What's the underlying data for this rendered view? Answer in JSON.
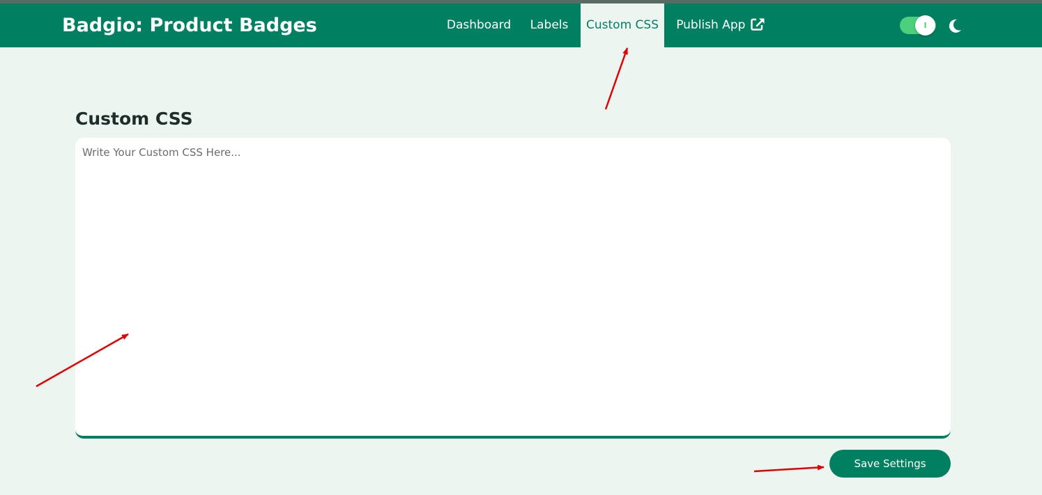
{
  "app": {
    "title": "Badgio: Product Badges"
  },
  "nav": {
    "items": [
      {
        "label": "Dashboard",
        "active": false
      },
      {
        "label": "Labels",
        "active": false
      },
      {
        "label": "Custom CSS",
        "active": true
      },
      {
        "label": "Publish App",
        "active": false,
        "icon": "external-link-icon"
      }
    ]
  },
  "theme_toggle": {
    "state": "on",
    "knob_label": "I",
    "icon": "moon-icon"
  },
  "main": {
    "title": "Custom CSS",
    "editor": {
      "value": "",
      "placeholder": "Write Your Custom CSS Here..."
    },
    "save_label": "Save Settings"
  },
  "colors": {
    "brand": "#008060",
    "page_background": "#edf5f1",
    "toggle_on": "#4cd07d",
    "annotation": "#e00000"
  }
}
